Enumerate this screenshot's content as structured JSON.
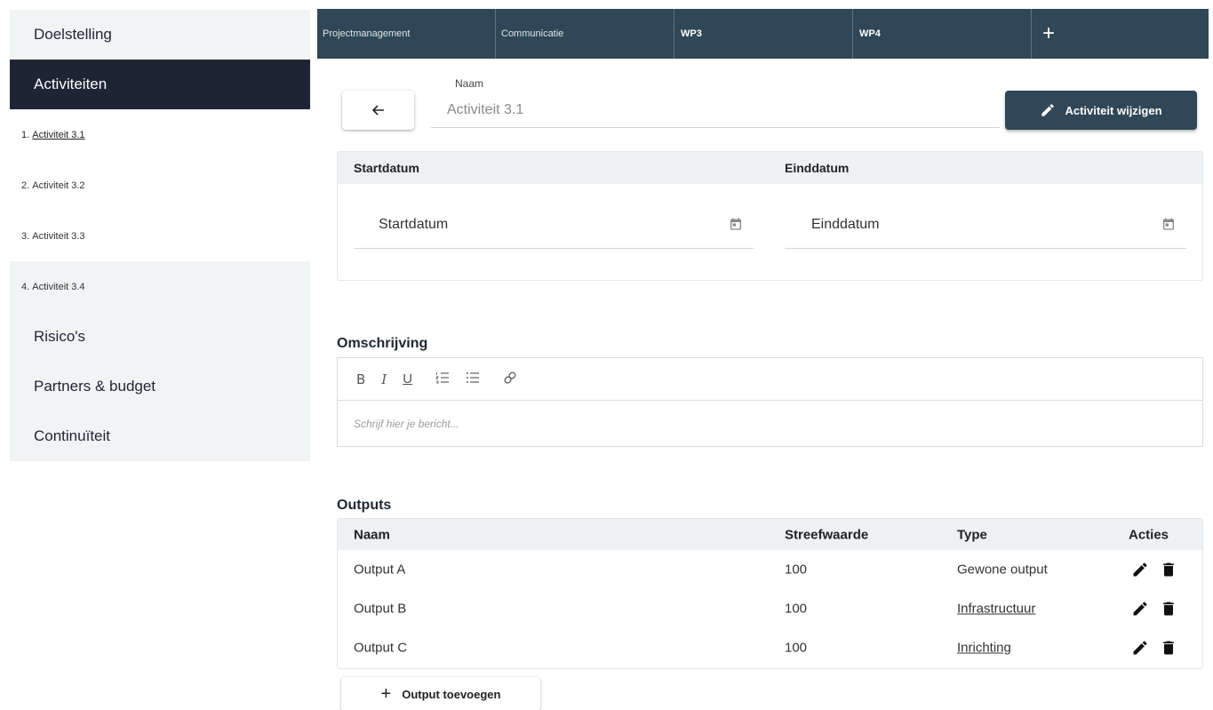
{
  "sidebar": {
    "items": [
      {
        "label": "Doelstelling"
      },
      {
        "label": "Activiteiten"
      },
      {
        "label": "Risico's"
      },
      {
        "label": "Partners & budget"
      },
      {
        "label": "Continuïteit"
      }
    ],
    "subitems": [
      {
        "number": "1.",
        "label": "Activiteit 3.1"
      },
      {
        "number": "2.",
        "label": "Activiteit 3.2"
      },
      {
        "number": "3.",
        "label": "Activiteit 3.3"
      },
      {
        "number": "4.",
        "label": "Activiteit 3.4"
      }
    ]
  },
  "tabs": [
    {
      "label": "Projectmanagement"
    },
    {
      "label": "Communicatie"
    },
    {
      "label": "WP3"
    },
    {
      "label": "WP4"
    }
  ],
  "tabs_add": "+",
  "header": {
    "back_icon": "arrow-left-icon",
    "name_label": "Naam",
    "name_value": "Activiteit 3.1",
    "edit_button": "Activiteit wijzigen"
  },
  "dates": {
    "start_header": "Startdatum",
    "end_header": "Einddatum",
    "start_placeholder": "Startdatum",
    "end_placeholder": "Einddatum"
  },
  "description": {
    "title": "Omschrijving",
    "toolbar": {
      "bold": "B",
      "italic": "I",
      "underline": "U"
    },
    "placeholder": "Schrijf hier je bericht..."
  },
  "outputs": {
    "title": "Outputs",
    "columns": {
      "name": "Naam",
      "target": "Streefwaarde",
      "type": "Type",
      "actions": "Acties"
    },
    "rows": [
      {
        "name": "Output A",
        "target": "100",
        "type": "Gewone output"
      },
      {
        "name": "Output B",
        "target": "100",
        "type": "Infrastructuur"
      },
      {
        "name": "Output C",
        "target": "100",
        "type": "Inrichting"
      }
    ],
    "add_button": "Output toevoegen"
  },
  "colors": {
    "sidebar_active": "#1d2535",
    "tab_bar": "#2f4756",
    "panel_header": "#eef1f4"
  }
}
